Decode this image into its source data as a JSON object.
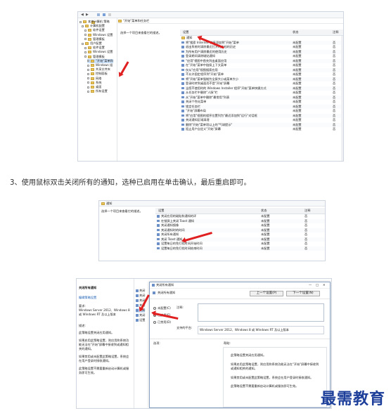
{
  "shot1": {
    "breadcrumb": "\"开始\"菜单和任务栏",
    "desc": "选择一个项目来查看它的描述。",
    "col_headers": [
      "设置",
      "状态",
      "注释"
    ],
    "tree": [
      "本地计算机 策略",
      "计算机配置",
      "软件设置",
      "Windows 设置",
      "管理模板",
      "用户配置",
      "软件设置",
      "Windows 设置",
      "管理模板",
      "\"开始\"菜单和",
      "Windows 组",
      "共享文件夹",
      "控制面板",
      "网络",
      "系统",
      "桌面",
      "所有设置"
    ],
    "rows": [
      {
        "name": "通知",
        "state": "",
        "note": "",
        "folder": true
      },
      {
        "name": "将\"搜索 Internet\"链接添加到\"开始\"菜单",
        "state": "未配置",
        "note": "否"
      },
      {
        "name": "退出系统时清除最近打开的文档的历史",
        "state": "未配置",
        "note": "否"
      },
      {
        "name": "为所有用户清除最近的使用历史",
        "state": "未配置",
        "note": "否"
      },
      {
        "name": "登录期间清除磁贴通知",
        "state": "未配置",
        "note": "否"
      },
      {
        "name": "\"应用\"视图中首先列出桌面应用",
        "state": "未配置",
        "note": "否"
      },
      {
        "name": "在\"开始\"菜单中链接上下文菜单",
        "state": "未配置",
        "note": "否"
      },
      {
        "name": "仅从\"应用\"视图搜索应用",
        "state": "未配置",
        "note": "否"
      },
      {
        "name": "不允许固定程序到\"开始\"菜单",
        "state": "未配置",
        "note": "否"
      },
      {
        "name": "将\"开始\"菜单强制为全屏大小或菜单大小",
        "state": "未配置",
        "note": "否"
      },
      {
        "name": "登录时转到桌面而不是\"开始\"屏幕",
        "state": "未配置",
        "note": "否"
      },
      {
        "name": "当您不使用时的 Windows Installer 程序\"开始\"菜单快捷方式",
        "state": "未配置",
        "note": "否"
      },
      {
        "name": "从任务栏中删除\"人脉\"栏",
        "state": "未配置",
        "note": "否"
      },
      {
        "name": "从\"开始\"菜单中删除\"最常用\"列表",
        "state": "未配置",
        "note": "否"
      },
      {
        "name": "关闭个性化菜单",
        "state": "未配置",
        "note": "否"
      },
      {
        "name": "锁定任务栏",
        "state": "未配置",
        "note": "否"
      },
      {
        "name": "\"开始\"屏幕布局",
        "state": "未配置",
        "note": "否"
      },
      {
        "name": "将\"应用\"视图的程序位置列为\"最近添加到\"运行\"对话框",
        "state": "未配置",
        "note": "否"
      },
      {
        "name": "关闭通知区域清理",
        "state": "未配置",
        "note": "否"
      },
      {
        "name": "删除\"开始\"菜单项以上的\"气球提示\"",
        "state": "未配置",
        "note": "否"
      },
      {
        "name": "阻止用户自定义\"开始\"屏幕",
        "state": "未配置",
        "note": "否"
      }
    ]
  },
  "step_text": "3、使用鼠标双击关闭所有的通知，选种已启用在单击确认，最后重启即可。",
  "shot2": {
    "breadcrumb": "通知",
    "desc": "选择一个项目来查看它的描述。",
    "col_headers": [
      "设置",
      "状态",
      "注释"
    ],
    "rows": [
      {
        "name": "关闭应用的磁贴和通知的环",
        "state": "未配置",
        "note": "否"
      },
      {
        "name": "在锁屏上关闭 Toast 通知",
        "state": "未配置",
        "note": "否"
      },
      {
        "name": "关闭通知镜像",
        "state": "未配置",
        "note": "否"
      },
      {
        "name": "关闭通知时的时间",
        "state": "未配置",
        "note": "否"
      },
      {
        "name": "关闭所有通知",
        "state": "未配置",
        "note": "否"
      },
      {
        "name": "关闭 Toast 通知",
        "state": "未配置",
        "note": "否"
      },
      {
        "name": "设置每日的免打扰时间开始时间",
        "state": "未配置",
        "note": "否"
      },
      {
        "name": "设置每日的免打扰时间结束时间",
        "state": "未配置",
        "note": "否"
      }
    ]
  },
  "shot3": {
    "left_title": "关闭所有通知",
    "left_link": "编辑策略设置",
    "req_label": "要求:",
    "req_text": "Windows Server 2012、Windows 8 或 Windows RT 及以上版本",
    "desc_label": "描述:",
    "desc_lines": [
      "此策略设置关闭应用通知。",
      "如果启用此策略设置，则应用和系统功能无法在\"开始\"屏幕中接收到或通知相关的通知。",
      "如果禁用或未配置此策略设置，系统会在用户登录时接收通知。",
      "此策略设置不需要重新启动计算机或服务即可生效。"
    ],
    "list_items": [
      "关闭",
      "关闭",
      "关闭",
      "关闭",
      "关闭",
      "关闭",
      "设置"
    ],
    "dialog_title": "关闭所有通知",
    "dialog_setting": "关闭所有通知",
    "prev_btn": "上一个设置(P)",
    "next_btn": "下一个设置(N)",
    "opt_notconfig": "未配置(C)",
    "opt_enabled": "已启用(E)",
    "opt_disabled": "已禁用(D)",
    "comment_label": "注释:",
    "support_label": "支持的平台:",
    "support_text": "Windows Server 2012、Windows 8 或 Windows RT 及以上版本",
    "options_label": "选项:",
    "help_label": "帮助:",
    "help_lines": [
      "此策略设置关闭应用通知。",
      "如果启用此策略设置，则应用和系统功能无法在\"开始\"屏幕中接收到或通知相关的通知。",
      "如果禁用或未配置此策略设置，系统会在用户登录时接收通知。",
      "此策略设置不需要重新启动计算机或服务即可生效。"
    ]
  },
  "watermark": "最需教育"
}
